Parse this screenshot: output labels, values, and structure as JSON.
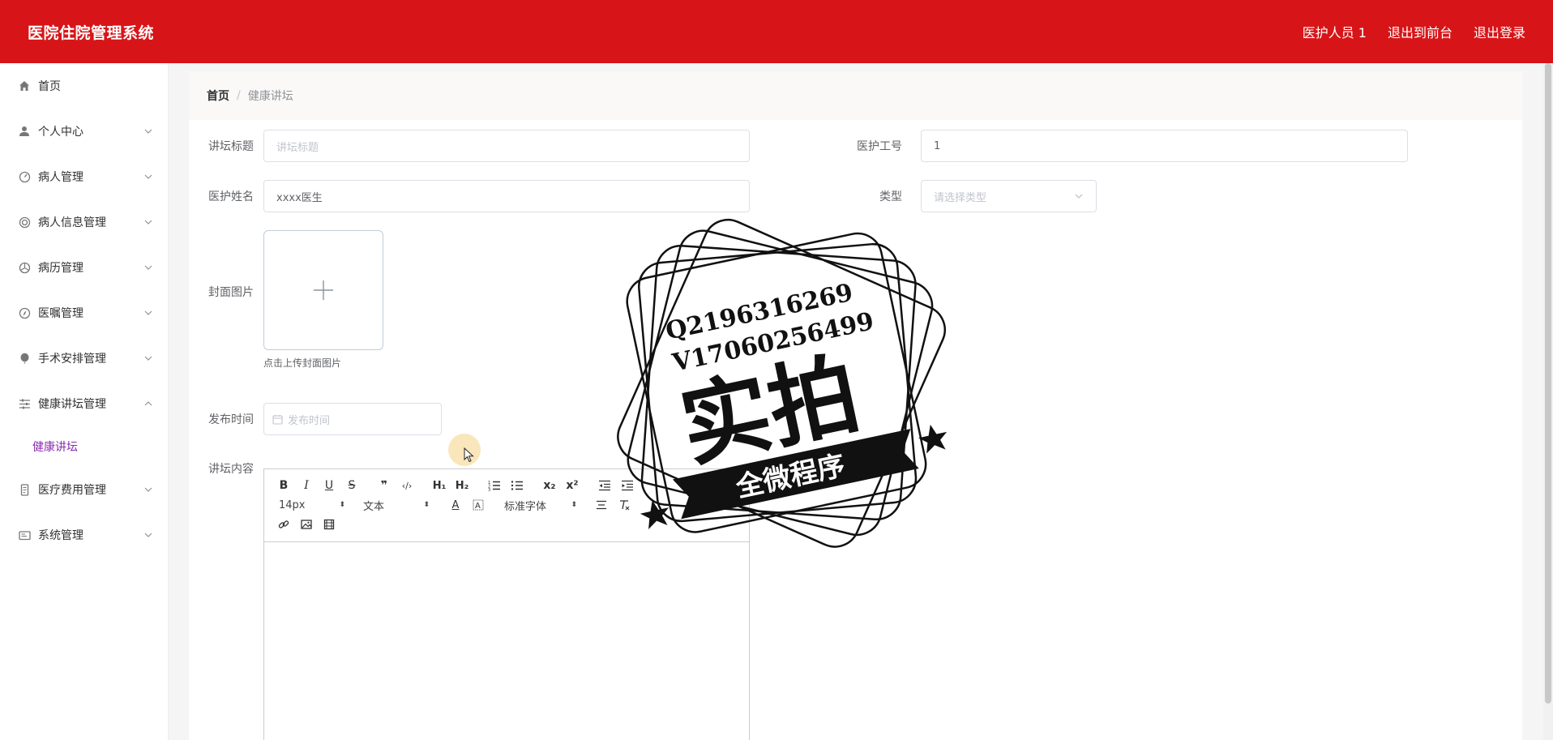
{
  "app": {
    "title": "医院住院管理系统"
  },
  "header": {
    "links": [
      "医护人员 1",
      "退出到前台",
      "退出登录"
    ]
  },
  "sidebar": {
    "items": [
      {
        "label": "首页",
        "icon": "home-icon",
        "expandable": false
      },
      {
        "label": "个人中心",
        "icon": "user-icon",
        "expandable": true
      },
      {
        "label": "病人管理",
        "icon": "gauge-icon",
        "expandable": true
      },
      {
        "label": "病人信息管理",
        "icon": "lifebuoy-icon",
        "expandable": true
      },
      {
        "label": "病历管理",
        "icon": "aperture-icon",
        "expandable": true
      },
      {
        "label": "医嘱管理",
        "icon": "compass-icon",
        "expandable": true
      },
      {
        "label": "手术安排管理",
        "icon": "balloon-icon",
        "expandable": true
      },
      {
        "label": "健康讲坛管理",
        "icon": "sliders-icon",
        "expandable": true,
        "expanded": true
      },
      {
        "label": "医疗费用管理",
        "icon": "receipt-icon",
        "expandable": true
      },
      {
        "label": "系统管理",
        "icon": "id-card-icon",
        "expandable": true
      }
    ],
    "submenu": {
      "label": "健康讲坛"
    },
    "active_color": "#8a2bb0"
  },
  "breadcrumb": {
    "home": "首页",
    "separator": "/",
    "current": "健康讲坛"
  },
  "form": {
    "title_label": "讲坛标题",
    "title_placeholder": "讲坛标题",
    "staff_no_label": "医护工号",
    "staff_no_value": "1",
    "staff_name_label": "医护姓名",
    "staff_name_value": "xxxx医生",
    "type_label": "类型",
    "type_placeholder": "请选择类型",
    "cover_label": "封面图片",
    "cover_hint": "点击上传封面图片",
    "publish_label": "发布时间",
    "publish_placeholder": "发布时间",
    "content_label": "讲坛内容"
  },
  "editor": {
    "size_select": "14px",
    "header_select": "文本",
    "font_select": "标准字体",
    "h1": "H₁",
    "h2": "H₂",
    "sub": "x₂",
    "sup": "x²"
  },
  "watermark": {
    "line1": "Q2196316269",
    "line2": "V17060256499",
    "big": "实拍",
    "banner": "全微程序"
  },
  "colors": {
    "header_bg": "#d71518",
    "accent": "#8a2bb0"
  }
}
